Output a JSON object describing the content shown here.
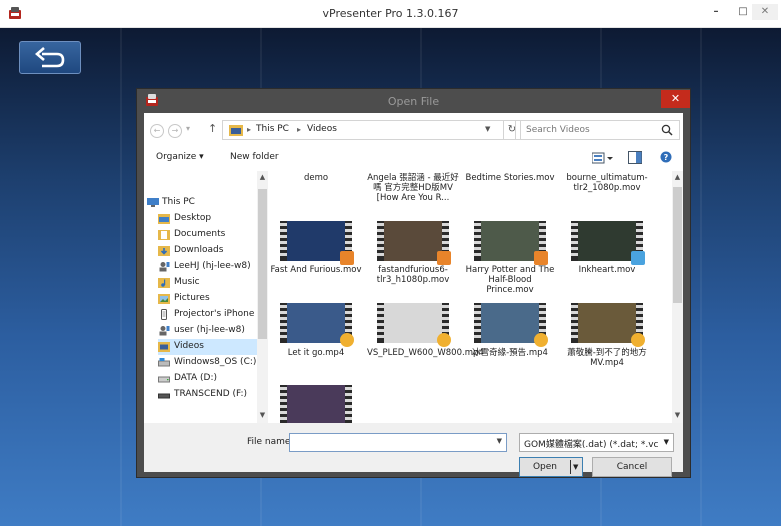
{
  "app": {
    "title": "vPresenter Pro 1.3.0.167",
    "window_buttons": {
      "minimize": "–",
      "maximize": "□",
      "close": "✕"
    }
  },
  "dialog": {
    "title": "Open File",
    "close": "✕",
    "address": {
      "crumbs": [
        "This PC",
        "Videos"
      ],
      "separator": "▸"
    },
    "search": {
      "placeholder": "Search Videos"
    },
    "toolbar": {
      "organize": "Organize ▾",
      "new_folder": "New folder"
    },
    "nav_items": [
      {
        "label": "This PC",
        "icon": "computer-icon"
      },
      {
        "label": "Desktop",
        "icon": "desktop-folder-icon"
      },
      {
        "label": "Documents",
        "icon": "documents-folder-icon"
      },
      {
        "label": "Downloads",
        "icon": "downloads-folder-icon"
      },
      {
        "label": "LeeHJ (hj-lee-w8)",
        "icon": "network-user-icon"
      },
      {
        "label": "Music",
        "icon": "music-folder-icon"
      },
      {
        "label": "Pictures",
        "icon": "pictures-folder-icon"
      },
      {
        "label": "Projector's iPhone",
        "icon": "phone-icon"
      },
      {
        "label": "user (hj-lee-w8)",
        "icon": "network-user-icon"
      },
      {
        "label": "Videos",
        "icon": "videos-folder-icon",
        "selected": true
      },
      {
        "label": "Windows8_OS (C:)",
        "icon": "drive-icon"
      },
      {
        "label": "DATA (D:)",
        "icon": "drive-icon"
      },
      {
        "label": "TRANSCEND (F:)",
        "icon": "usb-drive-icon"
      }
    ],
    "files_top": [
      {
        "name": "demo"
      },
      {
        "name": "Angela 張韶涵 - 最近好嗎 官方完整HD版MV [How Are You R..."
      },
      {
        "name": "Bedtime Stories.mov"
      },
      {
        "name": "bourne_ultimatum-tlr2_1080p.mov"
      }
    ],
    "files": [
      {
        "name": "Fast And Furious.mov",
        "thumb": "#203a6a",
        "badge": "#e8842a"
      },
      {
        "name": "fastandfurious6-tlr3_h1080p.mov",
        "thumb": "#5a4a3a",
        "badge": "#e8842a"
      },
      {
        "name": "Harry Potter and The Half-Blood Prince.mov",
        "thumb": "#4e5a4a",
        "badge": "#e8842a"
      },
      {
        "name": "Inkheart.mov",
        "thumb": "#2f3a30",
        "badge": "#4aa3df"
      },
      {
        "name": "Let it go.mp4",
        "thumb": "#3a5a8a",
        "badge": "#f0b030"
      },
      {
        "name": "VS_PLED_W600_W800.mp4",
        "thumb": "#d8d8d8",
        "badge": "#f0b030"
      },
      {
        "name": "冰雪奇緣-預告.mp4",
        "thumb": "#4a6a8a",
        "badge": "#f0b030"
      },
      {
        "name": "蕭敬騰-到不了的地方MV.mp4",
        "thumb": "#6a5a3a",
        "badge": "#f0b030"
      },
      {
        "name": "",
        "thumb": "#4a3a5a",
        "badge": "#f0b030"
      }
    ],
    "file_name": {
      "label": "File name:",
      "value": ""
    },
    "file_type": "GOM媒體檔案(.dat) (*.dat; *.vc",
    "open_label": "Open",
    "cancel_label": "Cancel"
  }
}
